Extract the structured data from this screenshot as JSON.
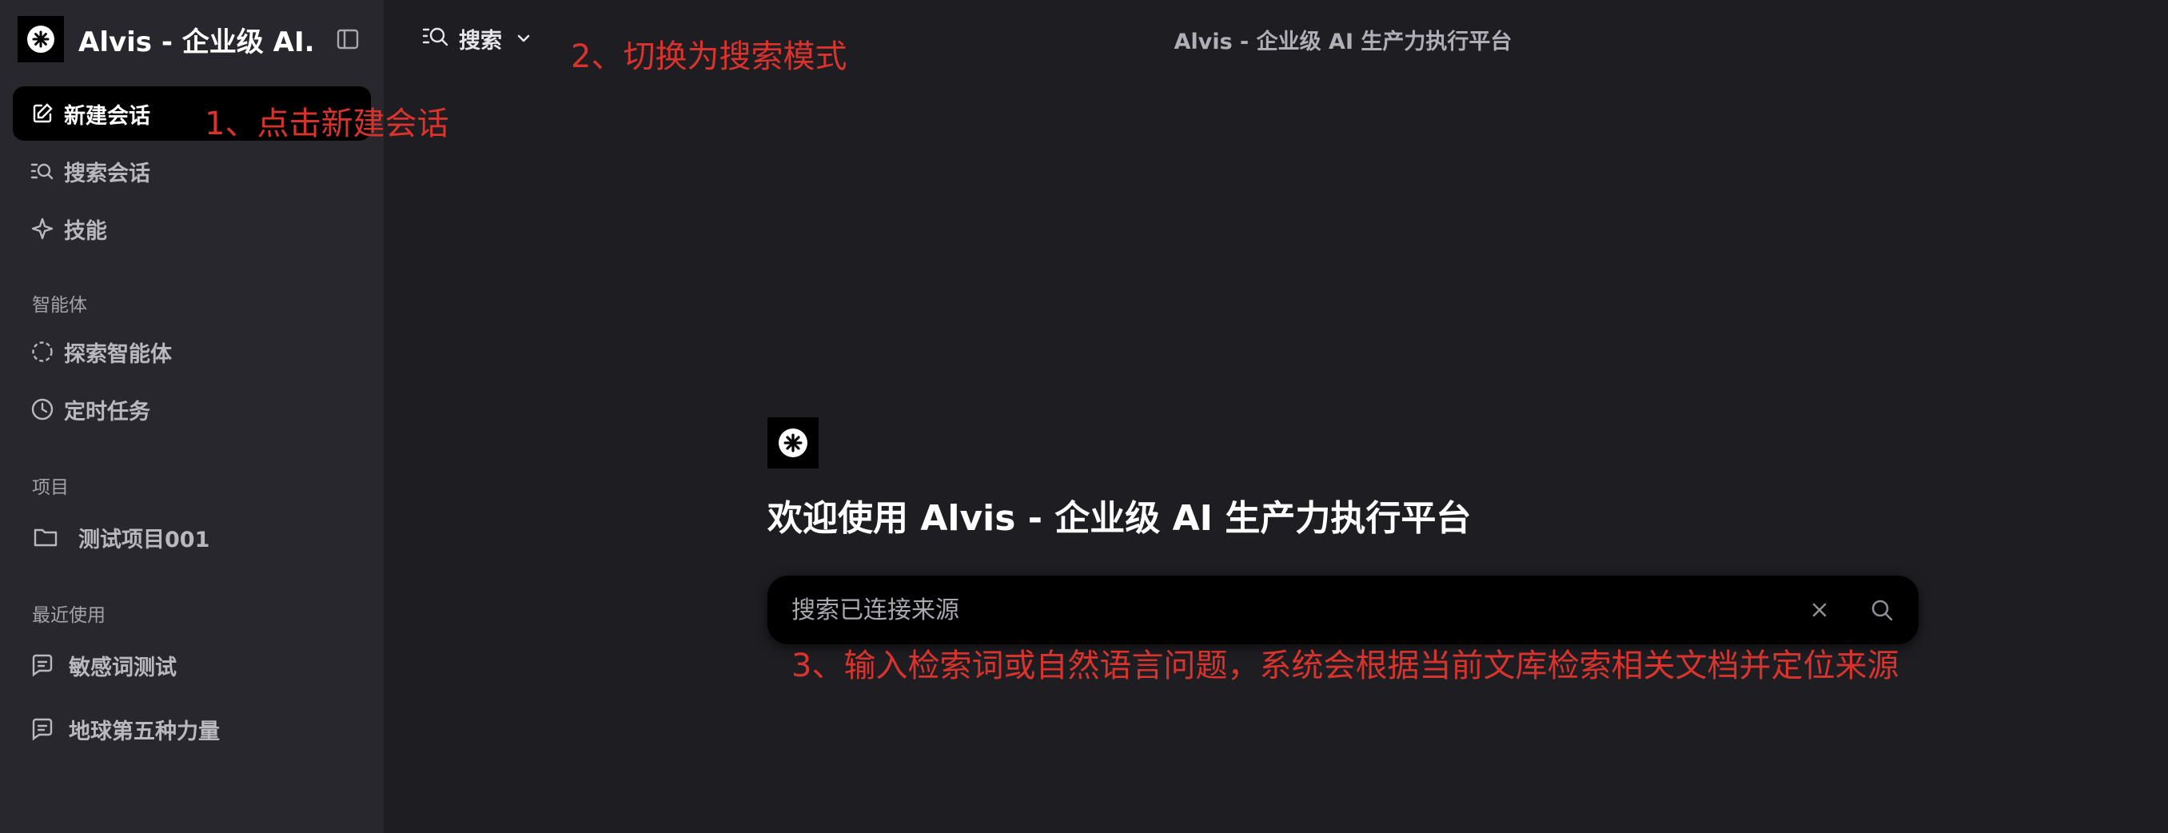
{
  "sidebar": {
    "brand_title": "Alvis - 企业级 AI...",
    "nav": {
      "new_chat": "新建会话",
      "search_chats": "搜索会话",
      "skills": "技能"
    },
    "agents_section": {
      "label": "智能体",
      "explore": "探索智能体",
      "scheduled": "定时任务"
    },
    "projects_section": {
      "label": "项目",
      "items": [
        {
          "label": "测试项目001"
        }
      ]
    },
    "recent_section": {
      "label": "最近使用",
      "items": [
        {
          "label": "敏感词测试"
        },
        {
          "label": "地球第五种力量"
        }
      ]
    }
  },
  "header": {
    "mode_label": "搜索",
    "title": "Alvis - 企业级 AI 生产力执行平台"
  },
  "main": {
    "welcome_title": "欢迎使用 Alvis - 企业级 AI 生产力执行平台",
    "search_placeholder": "搜索已连接来源",
    "search_value": ""
  },
  "annotations": {
    "step1": "1、点击新建会话",
    "step2": "2、切换为搜索模式",
    "step3": "3、输入检索词或自然语言问题，系统会根据当前文库检索相关文档并定位来源"
  },
  "colors": {
    "background": "#1e1d22",
    "sidebar": "#28272d",
    "active_item": "#000000",
    "annotation": "#d8342d"
  }
}
